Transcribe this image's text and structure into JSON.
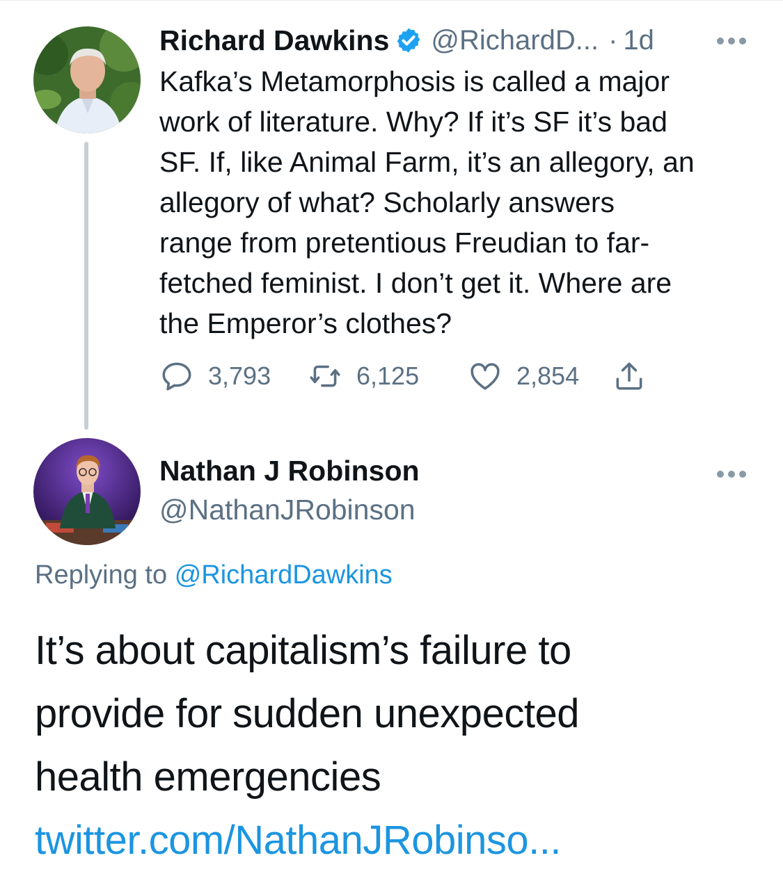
{
  "colors": {
    "text": "#0f1419",
    "muted": "#5b7083",
    "link": "#1b95e0",
    "verified": "#1da1f2",
    "thread_line": "#c4cfd6"
  },
  "tweet1": {
    "name": "Richard Dawkins",
    "verified_icon": "verified-badge-icon",
    "handle": "@RichardD...",
    "separator": "·",
    "time": "1d",
    "more_icon": "more-dots-icon",
    "text_lines": [
      "Kafka’s Metamorphosis is called a major",
      "work of literature. Why? If it’s SF it’s bad",
      "SF. If, like Animal Farm, it’s an allegory, an",
      "allegory of what? Scholarly answers",
      "range from pretentious Freudian to far-",
      "fetched feminist. I don’t get it. Where are",
      "the Emperor’s clothes?"
    ],
    "actions": {
      "reply": {
        "icon": "reply-icon",
        "count": "3,793"
      },
      "retweet": {
        "icon": "retweet-icon",
        "count": "6,125"
      },
      "like": {
        "icon": "heart-icon",
        "count": "2,854"
      },
      "share": {
        "icon": "share-icon"
      }
    }
  },
  "tweet2": {
    "name": "Nathan J Robinson",
    "handle": "@NathanJRobinson",
    "more_icon": "more-dots-icon",
    "replying_prefix": "Replying to",
    "replying_to": "@RichardDawkins",
    "text_lines": [
      "It’s about capitalism’s failure to",
      "provide for sudden unexpected",
      "health emergencies"
    ],
    "link": "twitter.com/NathanJRobinso..."
  }
}
